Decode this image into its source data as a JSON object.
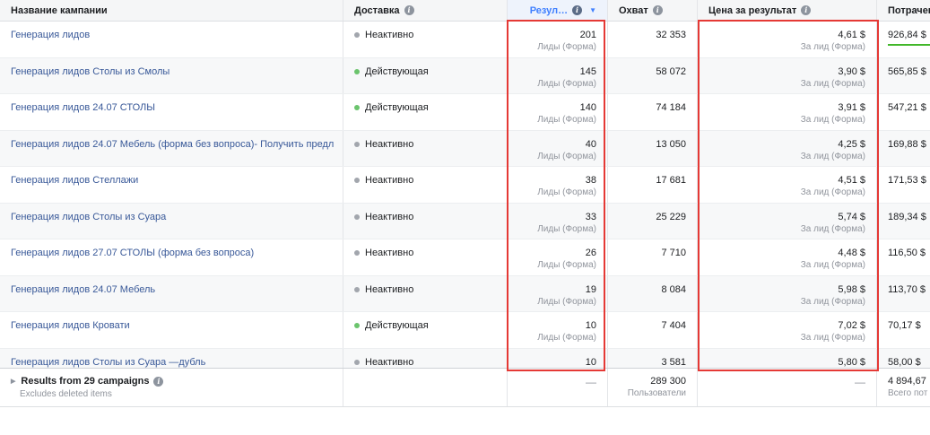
{
  "columns": {
    "name": "Название кампании",
    "delivery": "Доставка",
    "results": "Резул…",
    "reach": "Охват",
    "cost_per_result": "Цена за результат",
    "spent": "Потрачен"
  },
  "rows": [
    {
      "name": "Генерация лидов",
      "status": "Неактивно",
      "active": false,
      "results": "201",
      "results_sub": "Лиды (Форма)",
      "reach": "32 353",
      "cost": "4,61 $",
      "cost_sub": "За лид (Форма)",
      "spent": "926,84 $"
    },
    {
      "name": "Генерация лидов Столы из Смолы",
      "status": "Действующая",
      "active": true,
      "results": "145",
      "results_sub": "Лиды (Форма)",
      "reach": "58 072",
      "cost": "3,90 $",
      "cost_sub": "За лид (Форма)",
      "spent": "565,85 $"
    },
    {
      "name": "Генерация лидов 24.07 СТОЛЫ",
      "status": "Действующая",
      "active": true,
      "results": "140",
      "results_sub": "Лиды (Форма)",
      "reach": "74 184",
      "cost": "3,91 $",
      "cost_sub": "За лид (Форма)",
      "spent": "547,21 $"
    },
    {
      "name": "Генерация лидов 24.07 Мебель (форма без вопроса)- Получить предл",
      "status": "Неактивно",
      "active": false,
      "results": "40",
      "results_sub": "Лиды (Форма)",
      "reach": "13 050",
      "cost": "4,25 $",
      "cost_sub": "За лид (Форма)",
      "spent": "169,88 $"
    },
    {
      "name": "Генерация лидов Стеллажи",
      "status": "Неактивно",
      "active": false,
      "results": "38",
      "results_sub": "Лиды (Форма)",
      "reach": "17 681",
      "cost": "4,51 $",
      "cost_sub": "За лид (Форма)",
      "spent": "171,53 $"
    },
    {
      "name": "Генерация лидов Столы из Суара",
      "status": "Неактивно",
      "active": false,
      "results": "33",
      "results_sub": "Лиды (Форма)",
      "reach": "25 229",
      "cost": "5,74 $",
      "cost_sub": "За лид (Форма)",
      "spent": "189,34 $"
    },
    {
      "name": "Генерация лидов 27.07 СТОЛЫ (форма без вопроса)",
      "status": "Неактивно",
      "active": false,
      "results": "26",
      "results_sub": "Лиды (Форма)",
      "reach": "7 710",
      "cost": "4,48 $",
      "cost_sub": "За лид (Форма)",
      "spent": "116,50 $"
    },
    {
      "name": "Генерация лидов 24.07 Мебель",
      "status": "Неактивно",
      "active": false,
      "results": "19",
      "results_sub": "Лиды (Форма)",
      "reach": "8 084",
      "cost": "5,98 $",
      "cost_sub": "За лид (Форма)",
      "spent": "113,70 $"
    },
    {
      "name": "Генерация лидов Кровати",
      "status": "Действующая",
      "active": true,
      "results": "10",
      "results_sub": "Лиды (Форма)",
      "reach": "7 404",
      "cost": "7,02 $",
      "cost_sub": "За лид (Форма)",
      "spent": "70,17 $"
    },
    {
      "name": "Генерация лидов Столы из Суара —дубль",
      "status": "Неактивно",
      "active": false,
      "results": "10",
      "results_sub": "",
      "reach": "3 581",
      "cost": "5,80 $",
      "cost_sub": "",
      "spent": "58,00 $"
    }
  ],
  "footer": {
    "title": "Results from 29 campaigns",
    "subtitle": "Excludes deleted items",
    "results": "—",
    "reach": "289 300",
    "reach_sub": "Пользователи",
    "cost": "—",
    "spent": "4 894,67",
    "spent_sub": "Всего пот"
  },
  "colors": {
    "link": "#385898",
    "active_dot": "#6bc46d",
    "inactive_dot": "#a2a6ad",
    "highlight": "#e53935",
    "sorted_header": "#4080ff"
  },
  "icons": {
    "info": "info-icon",
    "sort": "sort-caret-icon",
    "expand": "expand-triangle-icon"
  }
}
